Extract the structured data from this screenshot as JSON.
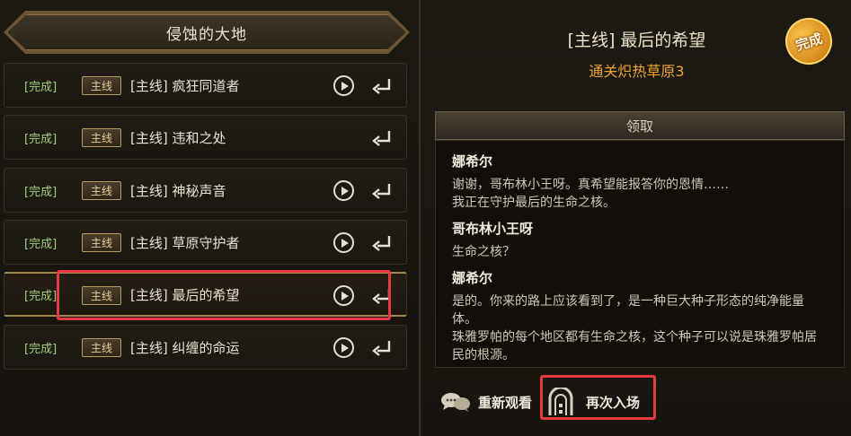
{
  "region": {
    "title": "侵蚀的大地"
  },
  "quests": [
    {
      "status": "[完成]",
      "tag": "主线",
      "name": "[主线] 疯狂同道者",
      "has_play": true
    },
    {
      "status": "[完成]",
      "tag": "主线",
      "name": "[主线] 违和之处",
      "has_play": false
    },
    {
      "status": "[完成]",
      "tag": "主线",
      "name": "[主线] 神秘声音",
      "has_play": true
    },
    {
      "status": "[完成]",
      "tag": "主线",
      "name": "[主线] 草原守护者",
      "has_play": true
    },
    {
      "status": "[完成]",
      "tag": "主线",
      "name": "[主线] 最后的希望",
      "has_play": true,
      "selected": true
    },
    {
      "status": "[完成]",
      "tag": "主线",
      "name": "[主线] 纠缠的命运",
      "has_play": true
    }
  ],
  "detail": {
    "title": "[主线] 最后的希望",
    "subtitle": "通关炽热草原3",
    "seal": "完成",
    "claim_label": "领取",
    "dialogue": [
      {
        "speaker": "娜希尔",
        "text": "谢谢，哥布林小王呀。真希望能报答你的恩情……\n我正在守护最后的生命之核。"
      },
      {
        "speaker": "哥布林小王呀",
        "text": "生命之核？"
      },
      {
        "speaker": "娜希尔",
        "text": "是的。你来的路上应该看到了，是一种巨大种子形态的纯净能量体。\n珠雅罗帕的每个地区都有生命之核，这个种子可以说是珠雅罗帕居民的根源。"
      }
    ],
    "rewatch_label": "重新观看",
    "reenter_label": "再次入场"
  },
  "colors": {
    "status_green": "#9fcf7a",
    "subtitle_orange": "#f0a531",
    "highlight_red": "#e33b3f",
    "tag_gold": "#e6cf95"
  },
  "icons": {
    "play": "play-circle-icon",
    "return": "return-arrow-icon",
    "rewatch": "speech-bubbles-icon",
    "reenter": "gate-portal-icon"
  }
}
